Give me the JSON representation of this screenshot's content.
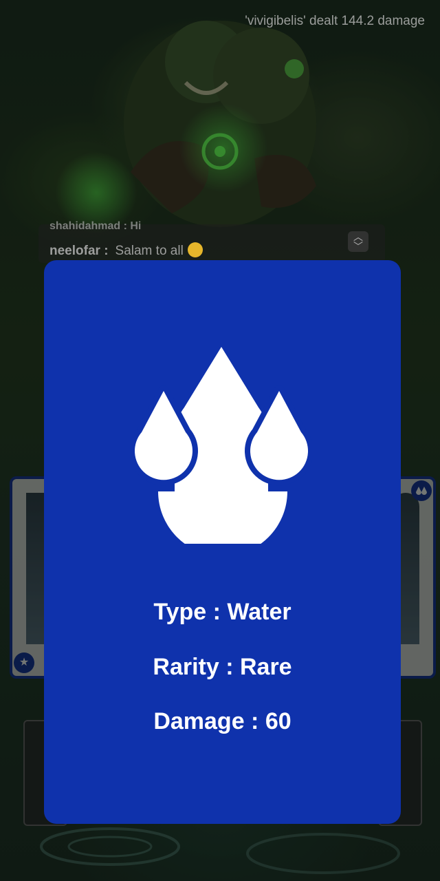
{
  "combat_log": {
    "message": "'vivigibelis' dealt 144.2 damage"
  },
  "chat": {
    "previous_line": "shahidahmad : Hi",
    "username": "neelofar :",
    "message": "Salam to all",
    "scroll_icon": "chevron-up-down-icon"
  },
  "card": {
    "element_icon": "water-drops-icon",
    "background_color": "#0f32ac",
    "type_line": "Type : Water",
    "rarity_line": "Rarity : Rare",
    "damage_line": "Damage : 60"
  },
  "side_cards": {
    "left_badge_icon": "star-icon",
    "right_badge_icon": "water-drops-icon"
  }
}
